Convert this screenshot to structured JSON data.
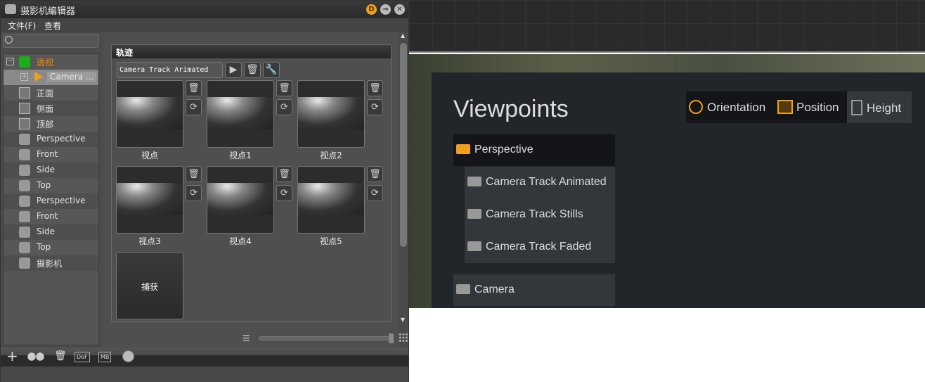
{
  "window": {
    "title": "摄影机编辑器",
    "controls": [
      "D",
      "→",
      "✕"
    ]
  },
  "menu": [
    "文件(F)",
    "查看"
  ],
  "search": {
    "placeholder": "",
    "value": ""
  },
  "tree": [
    {
      "label": "透视",
      "icon": "camera-icon",
      "color": "#ff8a00",
      "expander": "minus"
    },
    {
      "label": "Camera ...",
      "icon": "play-icon",
      "selected": true,
      "expander": "plus"
    },
    {
      "label": "正面",
      "icon": "cube-icon"
    },
    {
      "label": "侧面",
      "icon": "cube-icon"
    },
    {
      "label": "顶部",
      "icon": "cube-icon"
    },
    {
      "label": "Perspective",
      "icon": "camera-icon"
    },
    {
      "label": "Front",
      "icon": "camera-icon"
    },
    {
      "label": "Side",
      "icon": "camera-icon"
    },
    {
      "label": "Top",
      "icon": "camera-icon"
    },
    {
      "label": "Perspective",
      "icon": "camera-icon"
    },
    {
      "label": "Front",
      "icon": "camera-icon"
    },
    {
      "label": "Side",
      "icon": "camera-icon"
    },
    {
      "label": "Top",
      "icon": "camera-icon"
    },
    {
      "label": "摄影机",
      "icon": "camera-icon"
    }
  ],
  "track": {
    "header": "轨迹",
    "selected": "Camera Track Arimated"
  },
  "viewpoints": [
    "视点",
    "视点1",
    "视点2",
    "视点3",
    "视点4",
    "视点5"
  ],
  "capture_label": "捕获",
  "slider_value": 1.0,
  "toolbar": {
    "dof": "DoF",
    "mb": "MB"
  },
  "viewer": {
    "title": "Viewpoints",
    "tabs": [
      "Orientation",
      "Position",
      "Height"
    ],
    "active_tab": "Height",
    "groups": [
      {
        "label": "Perspective",
        "active": true,
        "children": [
          "Camera Track Animated",
          "Camera Track Stills",
          "Camera Track Faded"
        ]
      },
      {
        "label": "Camera"
      }
    ]
  },
  "colors": {
    "accent": "#f0a020",
    "tree_active": "#ff8a00"
  }
}
